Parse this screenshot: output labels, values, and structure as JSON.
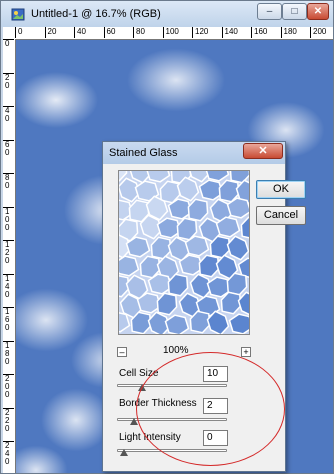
{
  "window": {
    "title": "Untitled-1 @ 16.7% (RGB)",
    "controls": {
      "minimize_glyph": "–",
      "maximize_glyph": "□",
      "close_glyph": "✕"
    }
  },
  "ruler": {
    "horizontal": [
      "0",
      "20",
      "40",
      "60",
      "80",
      "100",
      "120",
      "140",
      "160",
      "180",
      "200"
    ],
    "vertical": [
      "0",
      "2\n0",
      "4\n0",
      "6\n0",
      "8\n0",
      "1\n0\n0",
      "1\n2\n0",
      "1\n4\n0",
      "1\n6\n0",
      "1\n8\n0",
      "2\n0\n0",
      "2\n2\n0",
      "2\n4\n0"
    ]
  },
  "dialog": {
    "title": "Stained Glass",
    "close_glyph": "✕",
    "ok_label": "OK",
    "cancel_label": "Cancel",
    "zoom": {
      "value": "100%",
      "minus": "–",
      "plus": "+"
    },
    "params": [
      {
        "label": "Cell Size",
        "value": "10",
        "slider_level": 0.18
      },
      {
        "label": "Border Thickness",
        "value": "2",
        "slider_level": 0.1
      },
      {
        "label": "Light Intensity",
        "value": "0",
        "slider_level": 0.0
      }
    ]
  },
  "colors": {
    "canvas_blue": "#4f78c0",
    "annotation_red": "#d42a2a",
    "preview_cell_light": "#dbe5f7",
    "preview_cell_dark": "#5b85cf"
  }
}
